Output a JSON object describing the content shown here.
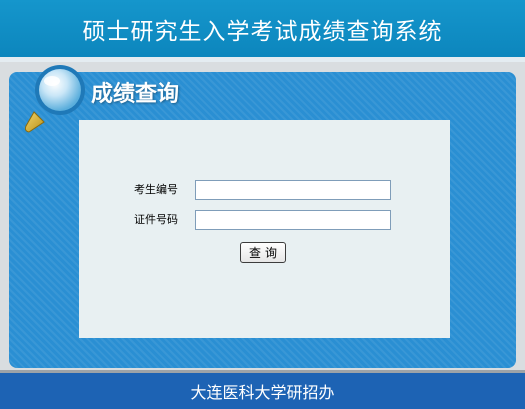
{
  "header": {
    "title": "硕士研究生入学考试成绩查询系统"
  },
  "panel": {
    "title": "成绩查询",
    "icon": "magnifier-icon"
  },
  "form": {
    "exam_number_label": "考生编号",
    "exam_number_value": "",
    "id_number_label": "证件号码",
    "id_number_value": "",
    "submit_label": "查询"
  },
  "footer": {
    "text": "大连医科大学研招办"
  },
  "colors": {
    "header_bg": "#0c86bd",
    "panel_bg": "#2a8fd3",
    "form_bg": "#e8f0f2",
    "footer_bg": "#1d63b4"
  }
}
